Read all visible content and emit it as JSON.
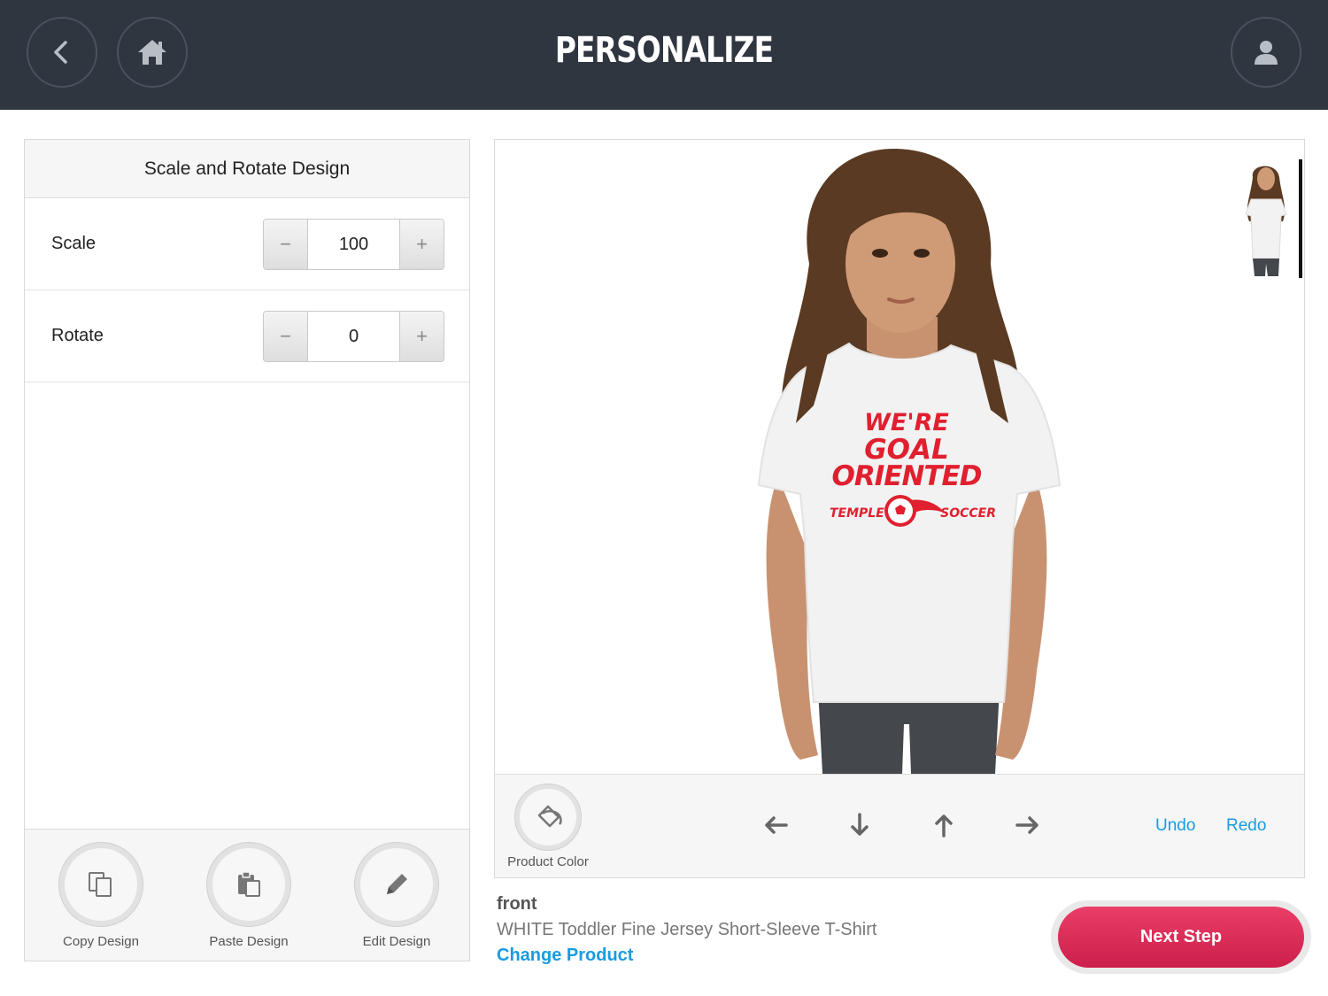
{
  "header": {
    "title": "PERSONALIZE",
    "back_icon": "chevron-left-icon",
    "home_icon": "home-icon",
    "user_icon": "user-icon"
  },
  "left_panel": {
    "title": "Scale and Rotate Design",
    "scale": {
      "label": "Scale",
      "value": "100",
      "minus": "−",
      "plus": "+"
    },
    "rotate": {
      "label": "Rotate",
      "value": "0",
      "minus": "−",
      "plus": "+"
    },
    "tools": [
      {
        "label": "Copy Design",
        "icon": "copy-icon"
      },
      {
        "label": "Paste Design",
        "icon": "paste-icon"
      },
      {
        "label": "Edit Design",
        "icon": "pencil-icon"
      }
    ]
  },
  "design": {
    "line1": "WE'RE",
    "line2": "GOAL",
    "line3": "ORIENTED",
    "left_word": "TEMPLE",
    "right_word": "SOCCER",
    "color": "#e0202f"
  },
  "toolbar": {
    "product_color_label": "Product Color",
    "undo": "Undo",
    "redo": "Redo"
  },
  "product": {
    "side": "front",
    "name": "WHITE Toddler Fine Jersey Short-Sleeve T-Shirt",
    "change_link": "Change Product"
  },
  "next_step": "Next Step",
  "colors": {
    "header_bg": "#2f3640",
    "accent_link": "#1a9be0",
    "cta": "#d62b55"
  }
}
